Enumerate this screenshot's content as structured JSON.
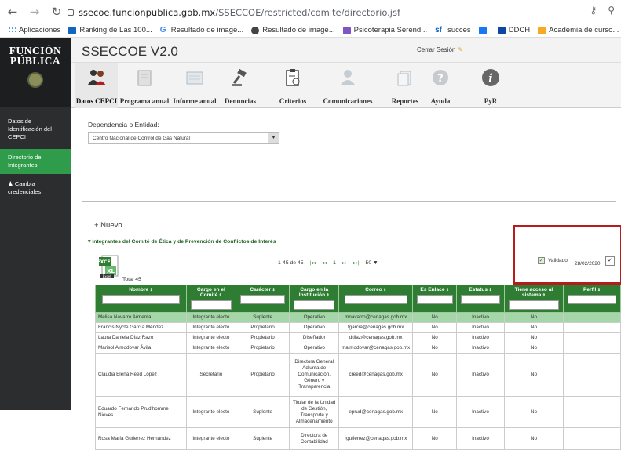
{
  "browser": {
    "url_host": "ssecoe.funcionpublica.gob.mx",
    "url_path": "/SSECCOE/restricted/comite/directorio.jsf",
    "bookmarks": [
      "Aplicaciones",
      "Ranking de Las 100...",
      "Resultado de image...",
      "Resultado de image...",
      "Psicoterapia Serend...",
      "succes",
      "",
      "DDCH",
      "Academia de curso..."
    ]
  },
  "sidebar": {
    "logo_line1": "FUNCIÓN",
    "logo_line2": "PÚBLICA",
    "items": [
      {
        "label": "Datos de Identificación del CEPCI"
      },
      {
        "label": "Directorio de Integrantes"
      },
      {
        "label": "Cambia credenciales"
      }
    ]
  },
  "header": {
    "title": "SSECCOE V2.0",
    "logout": "Cerrar Sesión"
  },
  "toolbar": {
    "items": [
      {
        "label": "Datos CEPCI",
        "icon": "people-icon"
      },
      {
        "label": "Programa anual",
        "icon": "book-icon"
      },
      {
        "label": "Informe anual",
        "icon": "report-icon"
      },
      {
        "label": "Denuncias",
        "icon": "gavel-icon"
      },
      {
        "label": "Criterios",
        "icon": "clipboard-icon"
      },
      {
        "label": "Comunicaciones",
        "icon": "handshake-icon"
      },
      {
        "label": "Reportes",
        "icon": "reports-icon"
      },
      {
        "label": "Ayuda",
        "icon": "help-icon"
      },
      {
        "label": "PyR",
        "icon": "info-icon"
      }
    ]
  },
  "content": {
    "dependencia_label": "Dependencia o Entidad:",
    "dependencia_value": "Centro Nacional de Control de Gas Natural",
    "nuevo": "+ Nuevo",
    "section_title": "Integrantes del Comité de Ética y de Prevención de Conflictos de Interés",
    "total": "Total 45",
    "pager_range": "1-45 de 45",
    "pager_page": "1",
    "pager_size": "50",
    "validado": "Validado",
    "fecha": "28/02/2020",
    "columns": [
      "Nombre",
      "Cargo en el Comité",
      "Carácter",
      "Cargo en la Institución",
      "Correo",
      "Es Enlace",
      "Estatus",
      "Tiene acceso al sistema",
      "Perfil"
    ],
    "rows": [
      [
        "Melisa Navarro Armenta",
        "Integrante electo",
        "Suplente",
        "Operativo",
        "mnavarro@cenagas.gob.mx",
        "No",
        "Inactivo",
        "No",
        ""
      ],
      [
        "Francis Nycte García Méndez",
        "Integrante electo",
        "Propietario",
        "Operativo",
        "fgarcia@cenagas.gob.mx",
        "No",
        "Inactivo",
        "No",
        ""
      ],
      [
        "Laura Daniela Díaz Razo",
        "Integrante electo",
        "Propietario",
        "Diseñador",
        "ddiaz@cenagas.gob.mx",
        "No",
        "Inactivo",
        "No",
        ""
      ],
      [
        "Marisol Almodovar Ávila",
        "Integrante electo",
        "Propietario",
        "Operativo",
        "malmodovar@cenagas.gob.mx",
        "No",
        "Inactivo",
        "No",
        ""
      ],
      [
        "Claudia Elena Reed López",
        "Secretario",
        "Propietario",
        "Directora General Adjunta de Comunicación, Género y Transparencia",
        "creed@cenagas.gob.mx",
        "No",
        "Inactivo",
        "No",
        ""
      ],
      [
        "Eduardo Fernando Prud'homme Nieves",
        "Integrante electo",
        "Suplente",
        "Titular de la Unidad de Gestión, Transporte y Almacenamiento",
        "eprud@cenagas.gob.mx",
        "No",
        "Inactivo",
        "No",
        ""
      ],
      [
        "Rosa María Gutierrez Hernández",
        "Integrante electo",
        "Suplente",
        "Directora de Contabilidad",
        "rgutierrez@cenagas.gob.mx",
        "No",
        "Inactivo",
        "No",
        ""
      ]
    ]
  }
}
